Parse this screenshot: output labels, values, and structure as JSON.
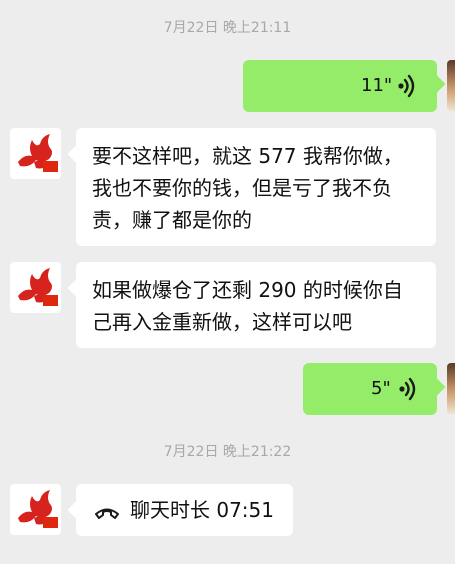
{
  "timestamps": [
    "7月22日 晚上21:11",
    "7月22日 晚上21:22"
  ],
  "messages": {
    "voice1": {
      "duration": "11\"",
      "icon": "voice-wave-icon"
    },
    "text1": {
      "text": "要不这样吧，就这 577 我帮你做，我也不要你的钱，但是亏了我不负责，赚了都是你的"
    },
    "text2": {
      "text": "如果做爆仓了还剩 290 的时候你自己再入金重新做，这样可以吧"
    },
    "voice2": {
      "duration": "5\"",
      "icon": "voice-wave-icon"
    },
    "call": {
      "label": "聊天时长 07:51",
      "icon": "phone-handset-icon"
    }
  },
  "colors": {
    "background": "#ededed",
    "outgoing_bubble": "#95ec69",
    "incoming_bubble": "#ffffff",
    "timestamp": "#a8a8a8",
    "avatar_logo": "#d7231e"
  }
}
